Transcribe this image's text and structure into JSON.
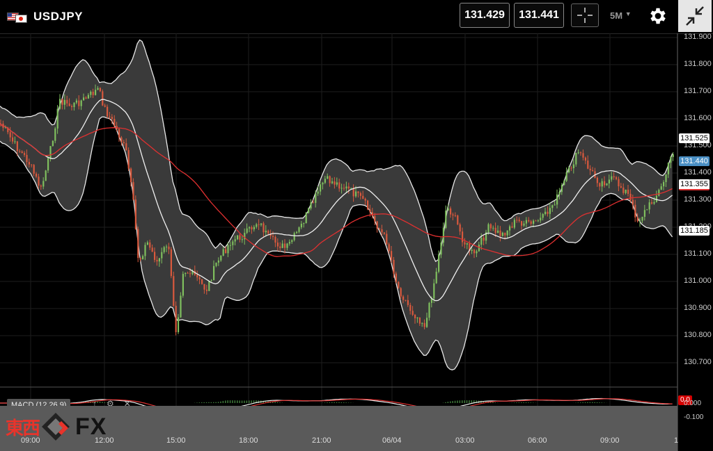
{
  "header": {
    "pair": "USDJPY",
    "bid": "131.429",
    "ask": "131.441",
    "timeframe": "5M",
    "icons": [
      "us-flag",
      "japan-flag",
      "crosshair-icon",
      "chevron-down-icon",
      "gear-icon",
      "collapse-icon"
    ]
  },
  "y_axis": {
    "labels": [
      "131.900",
      "131.800",
      "131.700",
      "131.600",
      "131.500",
      "131.400",
      "131.300",
      "131.200",
      "131.100",
      "131.000",
      "130.900",
      "130.800",
      "130.700"
    ],
    "tag_upper": "131.525",
    "tag_current": "131.440",
    "tag_middle": "131.355",
    "tag_lower": "131.185"
  },
  "macd": {
    "label": "MACD (12,26,9)",
    "zero_tag": "0.0",
    "axis_zero": "0.000",
    "axis_neg": "-0.100"
  },
  "x_axis": {
    "labels": [
      "09:00",
      "12:00",
      "15:00",
      "18:00",
      "21:00",
      "06/04",
      "03:00",
      "06:00",
      "09:00",
      "1"
    ]
  },
  "logo": {
    "kanji": "東西",
    "fx": "FX"
  },
  "colors": {
    "band_fill": "#3a3a3a",
    "up": "#7fbf5e",
    "down": "#d9593d",
    "ma_red": "#e03030",
    "tag_blue": "#4a8fc4"
  }
}
